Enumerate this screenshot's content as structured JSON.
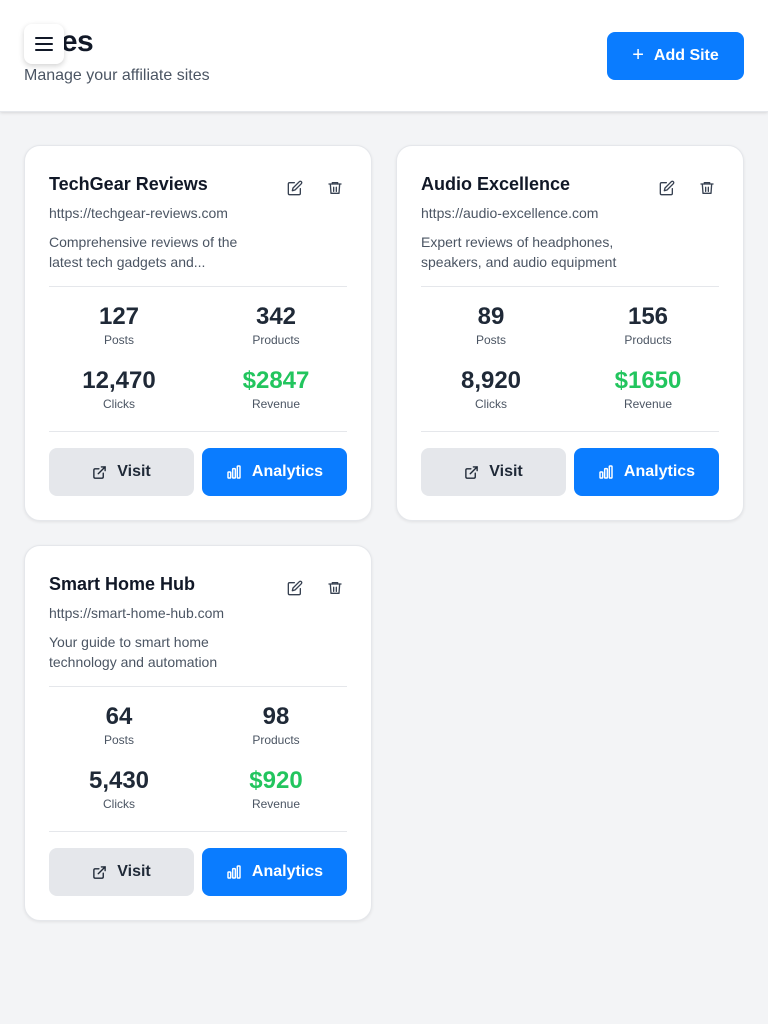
{
  "header": {
    "title": "Sites",
    "subtitle": "Manage your affiliate sites",
    "add_button_label": "Add Site",
    "add_button_icon": "+"
  },
  "stat_labels": {
    "posts": "Posts",
    "products": "Products",
    "clicks": "Clicks",
    "revenue": "Revenue"
  },
  "buttons": {
    "visit": "Visit",
    "analytics": "Analytics"
  },
  "sites": [
    {
      "name": "TechGear Reviews",
      "url": "https://techgear-reviews.com",
      "description": "Comprehensive reviews of the latest tech gadgets and...",
      "posts": "127",
      "products": "342",
      "clicks": "12,470",
      "revenue": "$2847"
    },
    {
      "name": "Audio Excellence",
      "url": "https://audio-excellence.com",
      "description": "Expert reviews of headphones, speakers, and audio equipment",
      "posts": "89",
      "products": "156",
      "clicks": "8,920",
      "revenue": "$1650"
    },
    {
      "name": "Smart Home Hub",
      "url": "https://smart-home-hub.com",
      "description": "Your guide to smart home technology and automation",
      "posts": "64",
      "products": "98",
      "clicks": "5,430",
      "revenue": "$920"
    }
  ],
  "colors": {
    "primary": "#0a7cff",
    "revenue": "#22c55e",
    "background": "#f3f4f6"
  }
}
